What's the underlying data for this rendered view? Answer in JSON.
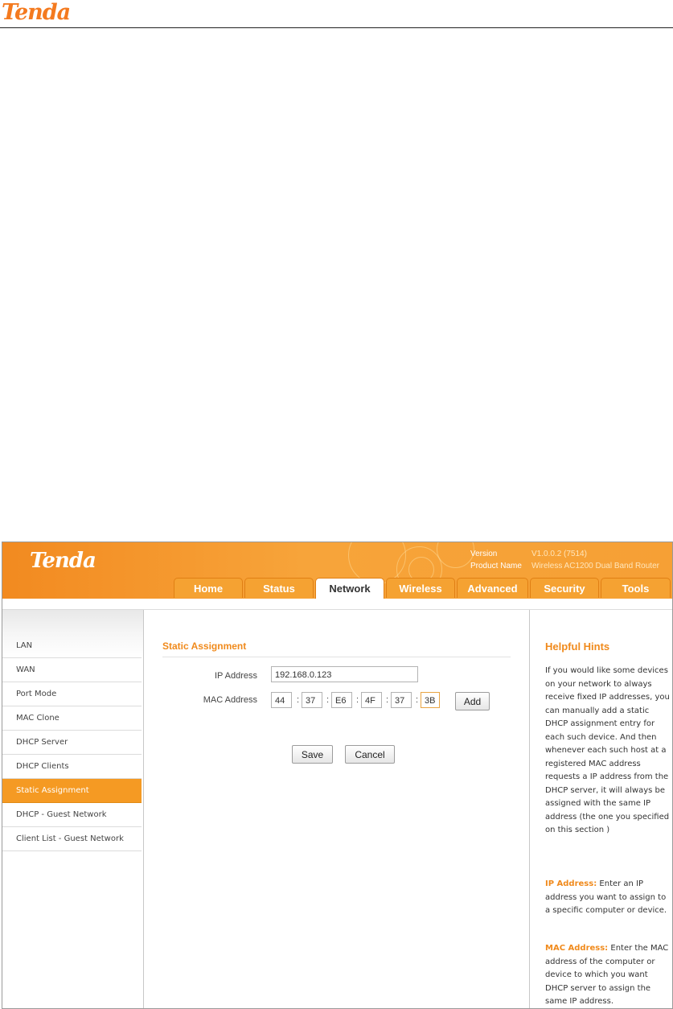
{
  "document": {
    "logo": "Tenda"
  },
  "header": {
    "logo": "Tenda",
    "version_label": "Version",
    "version_value": "V1.0.0.2 (7514)",
    "product_label": "Product Name",
    "product_value": "Wireless AC1200 Dual Band Router"
  },
  "tabs": [
    "Home",
    "Status",
    "Network",
    "Wireless",
    "Advanced",
    "Security",
    "Tools"
  ],
  "active_tab": "Network",
  "sidebar": {
    "items": [
      "LAN",
      "WAN",
      "Port Mode",
      "MAC Clone",
      "DHCP Server",
      "DHCP Clients",
      "Static Assignment",
      "DHCP - Guest Network",
      "Client List - Guest Network"
    ],
    "active": "Static Assignment"
  },
  "main": {
    "section_title": "Static Assignment",
    "ip_label": "IP Address",
    "ip_value": "192.168.0.123",
    "mac_label": "MAC Address",
    "mac": [
      "44",
      "37",
      "E6",
      "4F",
      "37",
      "3B"
    ],
    "colon": ":",
    "add_label": "Add",
    "save_label": "Save",
    "cancel_label": "Cancel"
  },
  "hints": {
    "title": "Helpful Hints",
    "intro": "If you would like some devices on your network to always receive fixed IP addresses, you can manually add a static DHCP assignment entry for each such device. And then whenever each such host at a registered MAC address requests a IP address from the DHCP server, it will always be assigned with the same IP address (the one you specified on this section )",
    "ip_key": "IP Address:",
    "ip_text": "Enter an IP address you want to assign to a specific computer or device.",
    "mac_key": "MAC Address:",
    "mac_text": "Enter the MAC address of the computer or device to which you want DHCP server to assign the same IP address."
  },
  "colors": {
    "accent": "#f08a1c",
    "header_orange": "#f28a20",
    "active_item": "#f59a23"
  }
}
